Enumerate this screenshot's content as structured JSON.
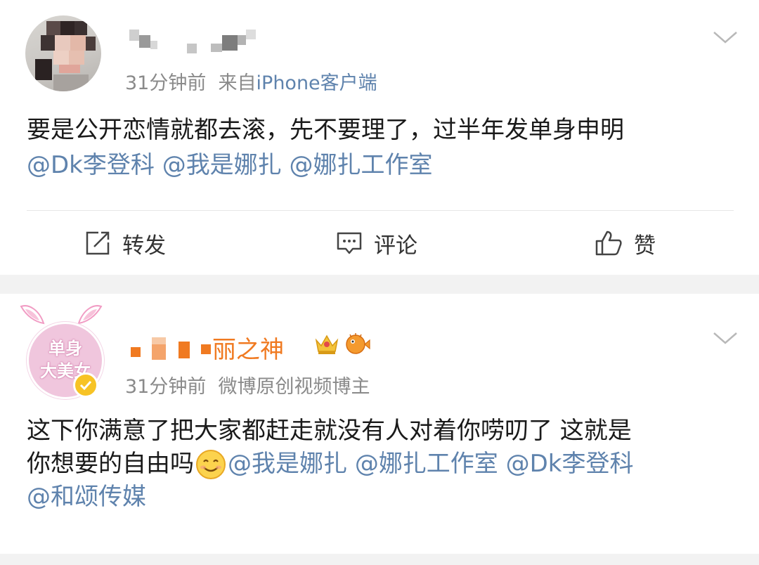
{
  "post1": {
    "time": "31分钟前",
    "source_prefix": "来自",
    "source_app": "iPhone客户端",
    "text": "要是公开恋情就都去滚，先不要理了，过半年发单身申明",
    "mentions": [
      "@Dk李登科",
      "@我是娜扎",
      "@娜扎工作室"
    ],
    "actions": {
      "repost": "转发",
      "comment": "评论",
      "like": "赞"
    }
  },
  "post2": {
    "avatar_text_line1": "单身",
    "avatar_text_line2": "大美女",
    "name_visible": "丽之神",
    "time": "31分钟前",
    "badge_text": "微博原创视频博主",
    "text_line1": "这下你满意了把大家都赶走就没有人对着你唠叨了 这就是",
    "text_line2_prefix": "你想要的自由吗",
    "mentions_line2": [
      "@我是娜扎",
      "@娜扎工作室",
      "@Dk李登科"
    ],
    "mention_line3": "@和颂传媒"
  },
  "colors": {
    "link": "#5f83ad",
    "meta": "#8a8a8a",
    "name_orange": "#f07a21",
    "separator": "#f2f2f2"
  }
}
